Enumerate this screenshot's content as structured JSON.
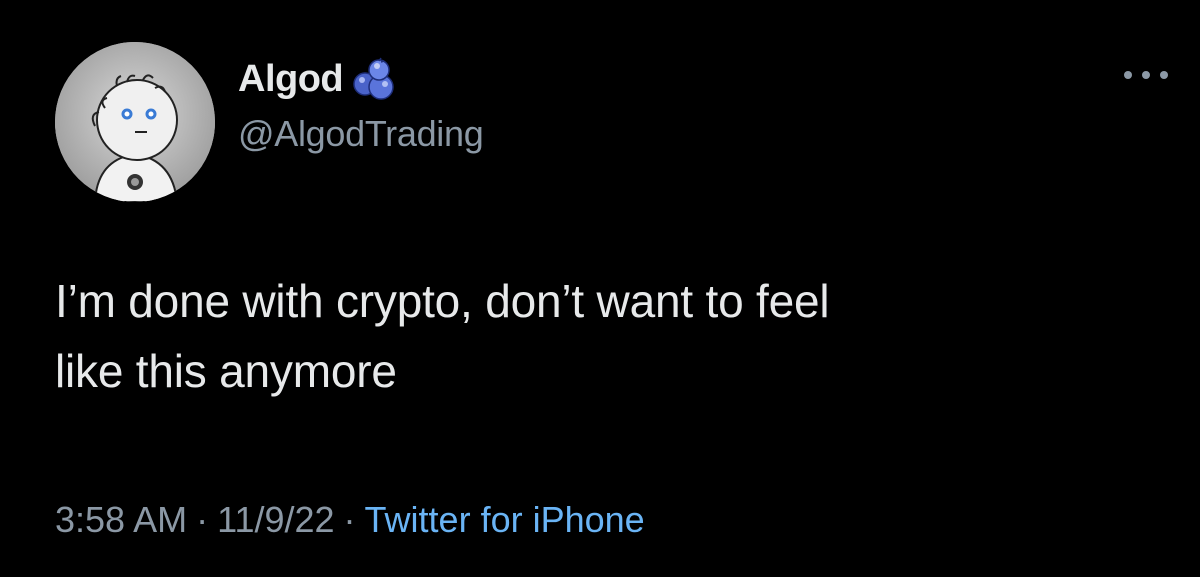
{
  "tweet": {
    "display_name": "Algod",
    "handle": "@AlgodTrading",
    "badge_icon": "blueberries-emoji-icon",
    "text_line_1": "I’m done with crypto, don’t want to feel",
    "text_line_2": "like this anymore",
    "time": "3:58 AM",
    "date": "11/9/22",
    "source": "Twitter for iPhone",
    "separator": "·"
  },
  "colors": {
    "background": "#000000",
    "primary_text": "#e7e9ea",
    "secondary_text": "#8b98a5",
    "link": "#6ab4f5"
  }
}
